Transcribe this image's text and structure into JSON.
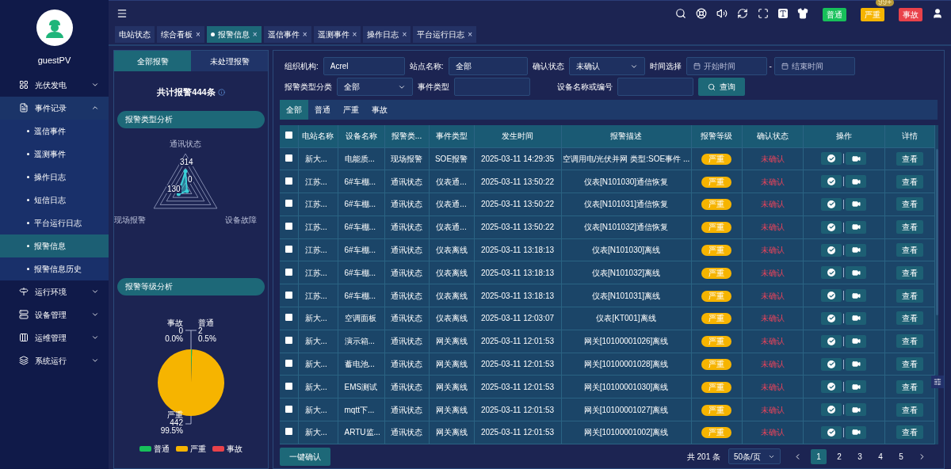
{
  "sidebar": {
    "user": "guestPV",
    "menu": [
      {
        "label": "光伏发电",
        "expanded": false
      },
      {
        "label": "事件记录",
        "expanded": true,
        "children": [
          {
            "label": "遥信事件",
            "selected": false
          },
          {
            "label": "遥测事件",
            "selected": false
          },
          {
            "label": "操作日志",
            "selected": false
          },
          {
            "label": "短信日志",
            "selected": false
          },
          {
            "label": "平台运行日志",
            "selected": false
          },
          {
            "label": "报警信息",
            "selected": true
          },
          {
            "label": "报警信息历史",
            "selected": false
          }
        ]
      },
      {
        "label": "运行环境",
        "expanded": false
      },
      {
        "label": "设备管理",
        "expanded": false
      },
      {
        "label": "运维管理",
        "expanded": false
      },
      {
        "label": "系统运行",
        "expanded": false
      }
    ]
  },
  "header": {
    "alert_buttons": [
      {
        "label": "普通",
        "color": "#17c05a"
      },
      {
        "label": "严重",
        "color": "#f6b400",
        "badge": "99+"
      },
      {
        "label": "事故",
        "color": "#e9424a"
      }
    ]
  },
  "page_tabs": [
    {
      "label": "电站状态",
      "selected": false
    },
    {
      "label": "综合看板",
      "selected": false,
      "close_icon": "×"
    },
    {
      "label": "报警信息",
      "selected": true,
      "close_icon": "×"
    },
    {
      "label": "遥信事件",
      "selected": false,
      "close_icon": "×"
    },
    {
      "label": "遥测事件",
      "selected": false,
      "close_icon": "×"
    },
    {
      "label": "操作日志",
      "selected": false,
      "close_icon": "×"
    },
    {
      "label": "平台运行日志",
      "selected": false,
      "close_icon": "×"
    }
  ],
  "summary": {
    "tabs": [
      {
        "label": "全部报警",
        "selected": true
      },
      {
        "label": "未处理报警",
        "selected": false
      }
    ],
    "total": "共计报警444条",
    "type_section": "报警类型分析",
    "radar": {
      "axes": [
        {
          "label": "通讯状态",
          "value": "314"
        },
        {
          "label": "现场报警",
          "value": "130"
        },
        {
          "label": "设备故障",
          "value": "0"
        }
      ]
    },
    "level_section": "报警等级分析",
    "pie_labels": [
      {
        "name": "事故",
        "count": "0",
        "percent": "0.0%"
      },
      {
        "name": "普通",
        "count": "2",
        "percent": "0.5%"
      },
      {
        "name": "严重",
        "count": "442",
        "percent": "99.5%"
      }
    ],
    "chart_data": {
      "type": "pie",
      "categories": [
        "普通",
        "严重",
        "事故"
      ],
      "values": [
        0.5,
        99.5,
        0.0
      ],
      "colors": [
        "#17c05a",
        "#f6b400",
        "#e9424a"
      ]
    }
  },
  "filters": {
    "org_label": "组织机构:",
    "org_value": "Acrel",
    "site_label": "站点名称:",
    "site_value": "全部",
    "confirm_label": "确认状态",
    "confirm_value": "未确认",
    "time_label": "时间选择",
    "start_placeholder": "开始时间",
    "range_sep": "-",
    "end_placeholder": "结束时间",
    "category_label": "报警类型分类",
    "category_value": "全部",
    "event_label": "事件类型",
    "device_label": "设备名称或编号",
    "search_button": "查询"
  },
  "level_tabs": [
    {
      "label": "全部",
      "selected": true
    },
    {
      "label": "普通",
      "selected": false
    },
    {
      "label": "严重",
      "selected": false
    },
    {
      "label": "事故",
      "selected": false
    }
  ],
  "table": {
    "select_all_checked": false,
    "columns": [
      "电站名称",
      "设备名称",
      "报警类...",
      "事件类型",
      "发生时间",
      "报警描述",
      "报警等级",
      "确认状态",
      "操作",
      "详情"
    ],
    "rows": [
      {
        "checked": false,
        "cells": [
          "新大...",
          "电能质...",
          "现场报警",
          "SOE报警",
          "2025-03-11 14:29:35",
          "空调用电/光伏并网 类型:SOE事件 ..."
        ],
        "grade": "严重",
        "color": "#f6b400",
        "confirmed": false,
        "status": "未确认",
        "detail": "查看"
      },
      {
        "checked": false,
        "cells": [
          "江苏...",
          "6#车棚...",
          "通讯状态",
          "仪表通...",
          "2025-03-11 13:50:22",
          "仪表[N101030]通信恢复"
        ],
        "grade": "严重",
        "color": "#f6b400",
        "confirmed": false,
        "status": "未确认",
        "detail": "查看"
      },
      {
        "checked": false,
        "cells": [
          "江苏...",
          "6#车棚...",
          "通讯状态",
          "仪表通...",
          "2025-03-11 13:50:22",
          "仪表[N101031]通信恢复"
        ],
        "grade": "严重",
        "color": "#f6b400",
        "confirmed": false,
        "status": "未确认",
        "detail": "查看"
      },
      {
        "checked": false,
        "cells": [
          "江苏...",
          "6#车棚...",
          "通讯状态",
          "仪表通...",
          "2025-03-11 13:50:22",
          "仪表[N101032]通信恢复"
        ],
        "grade": "严重",
        "color": "#f6b400",
        "confirmed": false,
        "status": "未确认",
        "detail": "查看"
      },
      {
        "checked": false,
        "cells": [
          "江苏...",
          "6#车棚...",
          "通讯状态",
          "仪表离线",
          "2025-03-11 13:18:13",
          "仪表[N101030]离线"
        ],
        "grade": "严重",
        "color": "#f6b400",
        "confirmed": false,
        "status": "未确认",
        "detail": "查看"
      },
      {
        "checked": false,
        "cells": [
          "江苏...",
          "6#车棚...",
          "通讯状态",
          "仪表离线",
          "2025-03-11 13:18:13",
          "仪表[N101032]离线"
        ],
        "grade": "严重",
        "color": "#f6b400",
        "confirmed": false,
        "status": "未确认",
        "detail": "查看"
      },
      {
        "checked": false,
        "cells": [
          "江苏...",
          "6#车棚...",
          "通讯状态",
          "仪表离线",
          "2025-03-11 13:18:13",
          "仪表[N101031]离线"
        ],
        "grade": "严重",
        "color": "#f6b400",
        "confirmed": false,
        "status": "未确认",
        "detail": "查看"
      },
      {
        "checked": false,
        "cells": [
          "新大...",
          "空调面板",
          "通讯状态",
          "仪表离线",
          "2025-03-11 12:03:07",
          "仪表[KT001]离线"
        ],
        "grade": "严重",
        "color": "#f6b400",
        "confirmed": false,
        "status": "未确认",
        "detail": "查看"
      },
      {
        "checked": false,
        "cells": [
          "新大...",
          "演示箱...",
          "通讯状态",
          "网关离线",
          "2025-03-11 12:01:53",
          "网关[10100001026]离线"
        ],
        "grade": "严重",
        "color": "#f6b400",
        "confirmed": false,
        "status": "未确认",
        "detail": "查看"
      },
      {
        "checked": false,
        "cells": [
          "新大...",
          "蓄电池...",
          "通讯状态",
          "网关离线",
          "2025-03-11 12:01:53",
          "网关[10100001028]离线"
        ],
        "grade": "严重",
        "color": "#f6b400",
        "confirmed": false,
        "status": "未确认",
        "detail": "查看"
      },
      {
        "checked": false,
        "cells": [
          "新大...",
          "EMS测试",
          "通讯状态",
          "网关离线",
          "2025-03-11 12:01:53",
          "网关[10100001030]离线"
        ],
        "grade": "严重",
        "color": "#f6b400",
        "confirmed": false,
        "status": "未确认",
        "detail": "查看"
      },
      {
        "checked": false,
        "cells": [
          "新大...",
          "mqtt下...",
          "通讯状态",
          "网关离线",
          "2025-03-11 12:01:53",
          "网关[10100001027]离线"
        ],
        "grade": "严重",
        "color": "#f6b400",
        "confirmed": false,
        "status": "未确认",
        "detail": "查看"
      },
      {
        "checked": false,
        "cells": [
          "新大...",
          "ARTU监...",
          "通讯状态",
          "网关离线",
          "2025-03-11 12:01:53",
          "网关[10100001002]离线"
        ],
        "grade": "严重",
        "color": "#f6b400",
        "confirmed": false,
        "status": "未确认",
        "detail": "查看"
      }
    ]
  },
  "footer": {
    "confirm_all": "一键确认",
    "total": "共 201 条",
    "page_size": "50条/页",
    "pages": [
      {
        "label": "1",
        "selected": true
      },
      {
        "label": "2",
        "selected": false
      },
      {
        "label": "3",
        "selected": false
      },
      {
        "label": "4",
        "selected": false
      },
      {
        "label": "5",
        "selected": false
      }
    ]
  }
}
